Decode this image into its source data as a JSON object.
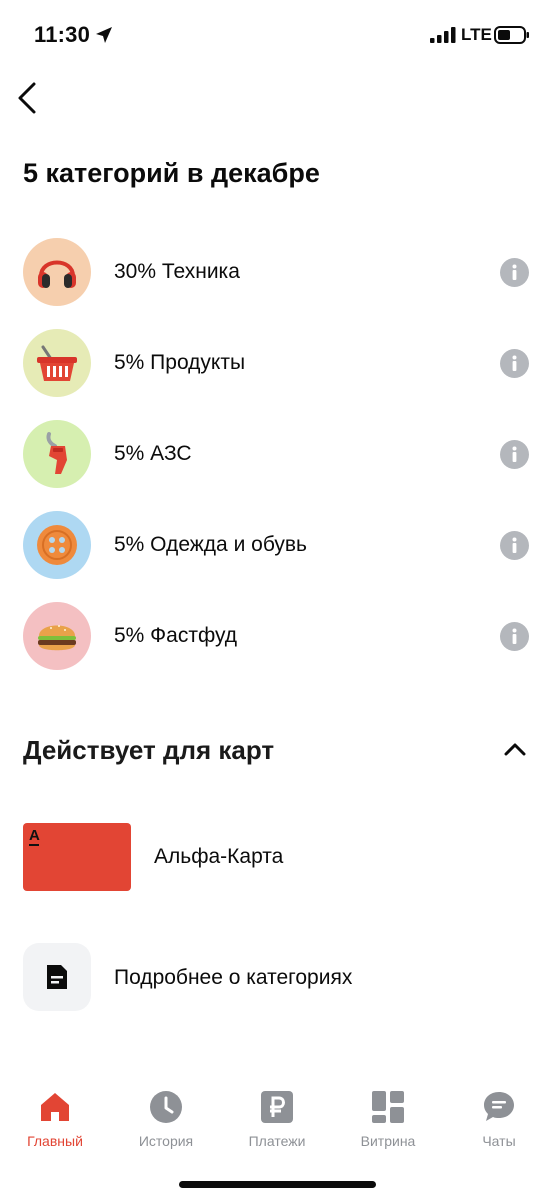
{
  "status_bar": {
    "time": "11:30",
    "network": "LTE"
  },
  "page": {
    "title": "5 категорий в декабре"
  },
  "categories": [
    {
      "label": "30% Техника",
      "icon": "headphones-icon",
      "bg": "#f6cfae"
    },
    {
      "label": "5% Продукты",
      "icon": "basket-icon",
      "bg": "#e6ebb6"
    },
    {
      "label": "5% АЗС",
      "icon": "fuel-nozzle-icon",
      "bg": "#d6efb0"
    },
    {
      "label": "5% Одежда и обувь",
      "icon": "button-icon",
      "bg": "#aed8f2"
    },
    {
      "label": "5% Фастфуд",
      "icon": "burger-icon",
      "bg": "#f4c0c2"
    }
  ],
  "cards_section": {
    "title": "Действует для карт",
    "cards": [
      {
        "label": "Альфа-Карта",
        "logo": "А",
        "color": "#e24534"
      }
    ]
  },
  "details": {
    "label": "Подробнее о категориях"
  },
  "tab_bar": {
    "tabs": [
      {
        "label": "Главный",
        "icon": "home-icon",
        "active": true
      },
      {
        "label": "История",
        "icon": "clock-icon",
        "active": false
      },
      {
        "label": "Платежи",
        "icon": "ruble-icon",
        "active": false
      },
      {
        "label": "Витрина",
        "icon": "showcase-icon",
        "active": false
      },
      {
        "label": "Чаты",
        "icon": "chat-icon",
        "active": false
      }
    ]
  },
  "colors": {
    "accent": "#e24534",
    "inactive": "#8e9196",
    "info_icon": "#b4b7bc"
  }
}
